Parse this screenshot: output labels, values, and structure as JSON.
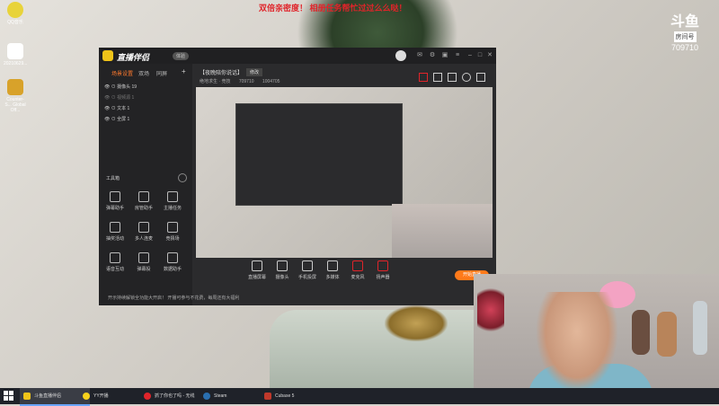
{
  "desktop": {
    "icons": [
      {
        "label": "QQ音乐"
      },
      {
        "label": "20210629..."
      },
      {
        "label": "Counter-S... Global Off..."
      }
    ]
  },
  "overlay": {
    "banner": "双倍亲密度！ 相册任务帮忙过过么么哒！",
    "douyu_logo": "斗鱼",
    "room_label": "房间号",
    "room_number": "709710"
  },
  "app": {
    "name": "直播伴侣",
    "version_badge": "体验",
    "sidebar_tabs": [
      "场景设置",
      "双场",
      "同屏"
    ],
    "sources": [
      {
        "label": "摄像头 19"
      },
      {
        "label": "视频源 1"
      },
      {
        "label": "文本 1"
      },
      {
        "label": "全屏 1"
      }
    ],
    "toolbox_title": "工具箱",
    "tools": [
      {
        "label": "弹幕助手",
        "icon": "chat-icon"
      },
      {
        "label": "房管助手",
        "icon": "user-icon"
      },
      {
        "label": "主播任务",
        "icon": "task-icon"
      },
      {
        "label": "抽奖活动",
        "icon": "gift-icon"
      },
      {
        "label": "多人连麦",
        "icon": "link-icon"
      },
      {
        "label": "竞猜场",
        "icon": "game-icon"
      },
      {
        "label": "语音互动",
        "icon": "mic-icon"
      },
      {
        "label": "弹幕投",
        "icon": "vote-icon"
      },
      {
        "label": "数据助手",
        "icon": "chart-icon"
      }
    ],
    "stream_title": "【夜晚陪你说话】",
    "tag_button": "修改",
    "info": {
      "category": "绝地求生 · 竞技",
      "id": "709710",
      "followers": "1004705"
    },
    "controls": [
      {
        "label": "直播屏幕",
        "icon": "screen-icon"
      },
      {
        "label": "摄像头",
        "icon": "camera-icon"
      },
      {
        "label": "手机投屏",
        "icon": "phone-icon"
      },
      {
        "label": "多媒体",
        "icon": "media-icon"
      },
      {
        "label": "麦克风",
        "icon": "mic-icon"
      },
      {
        "label": "扬声器",
        "icon": "speaker-icon"
      }
    ],
    "go_live": "开始直播",
    "tip": "开示持续解锁全功能大开启！ 开播可参与不花费，每周还有大福利"
  },
  "taskbar": {
    "items": [
      {
        "label": "斗鱼直播伴侣",
        "color": "#f0c419",
        "active": true
      },
      {
        "label": "YY开播",
        "color": "#f7d21c",
        "active": false
      },
      {
        "label": "抓了你也了吗 - 无线",
        "color": "#e0242a",
        "active": false
      },
      {
        "label": "Steam",
        "color": "#2a6fb0",
        "active": false
      },
      {
        "label": "Cubase 5",
        "color": "#c0392b",
        "active": false
      }
    ]
  }
}
